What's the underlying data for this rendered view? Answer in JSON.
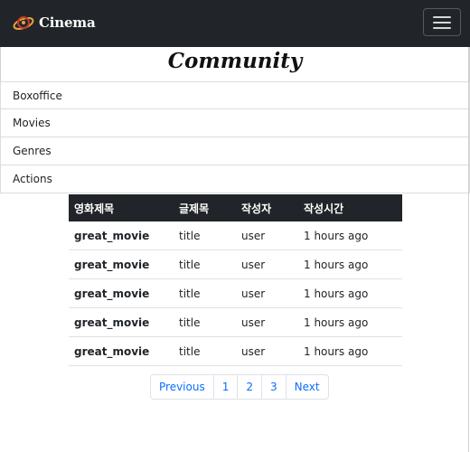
{
  "navbar": {
    "brand": "Cinema",
    "toggle_icon": "hamburger-icon"
  },
  "page": {
    "title": "Community"
  },
  "sidebar": {
    "items": [
      {
        "label": "Boxoffice"
      },
      {
        "label": "Movies"
      },
      {
        "label": "Genres"
      },
      {
        "label": "Actions"
      }
    ]
  },
  "table": {
    "headers": [
      "영화제목",
      "글제목",
      "작성자",
      "작성시간"
    ],
    "rows": [
      [
        "great_movie",
        "title",
        "user",
        "1 hours ago"
      ],
      [
        "great_movie",
        "title",
        "user",
        "1 hours ago"
      ],
      [
        "great_movie",
        "title",
        "user",
        "1 hours ago"
      ],
      [
        "great_movie",
        "title",
        "user",
        "1 hours ago"
      ],
      [
        "great_movie",
        "title",
        "user",
        "1 hours ago"
      ]
    ]
  },
  "pagination": {
    "previous": "Previous",
    "pages": [
      "1",
      "2",
      "3"
    ],
    "next": "Next"
  },
  "colors": {
    "navbar_bg": "#212529",
    "link": "#0d6efd",
    "logo_accent": "#e8a33d",
    "logo_red": "#c0392b"
  }
}
